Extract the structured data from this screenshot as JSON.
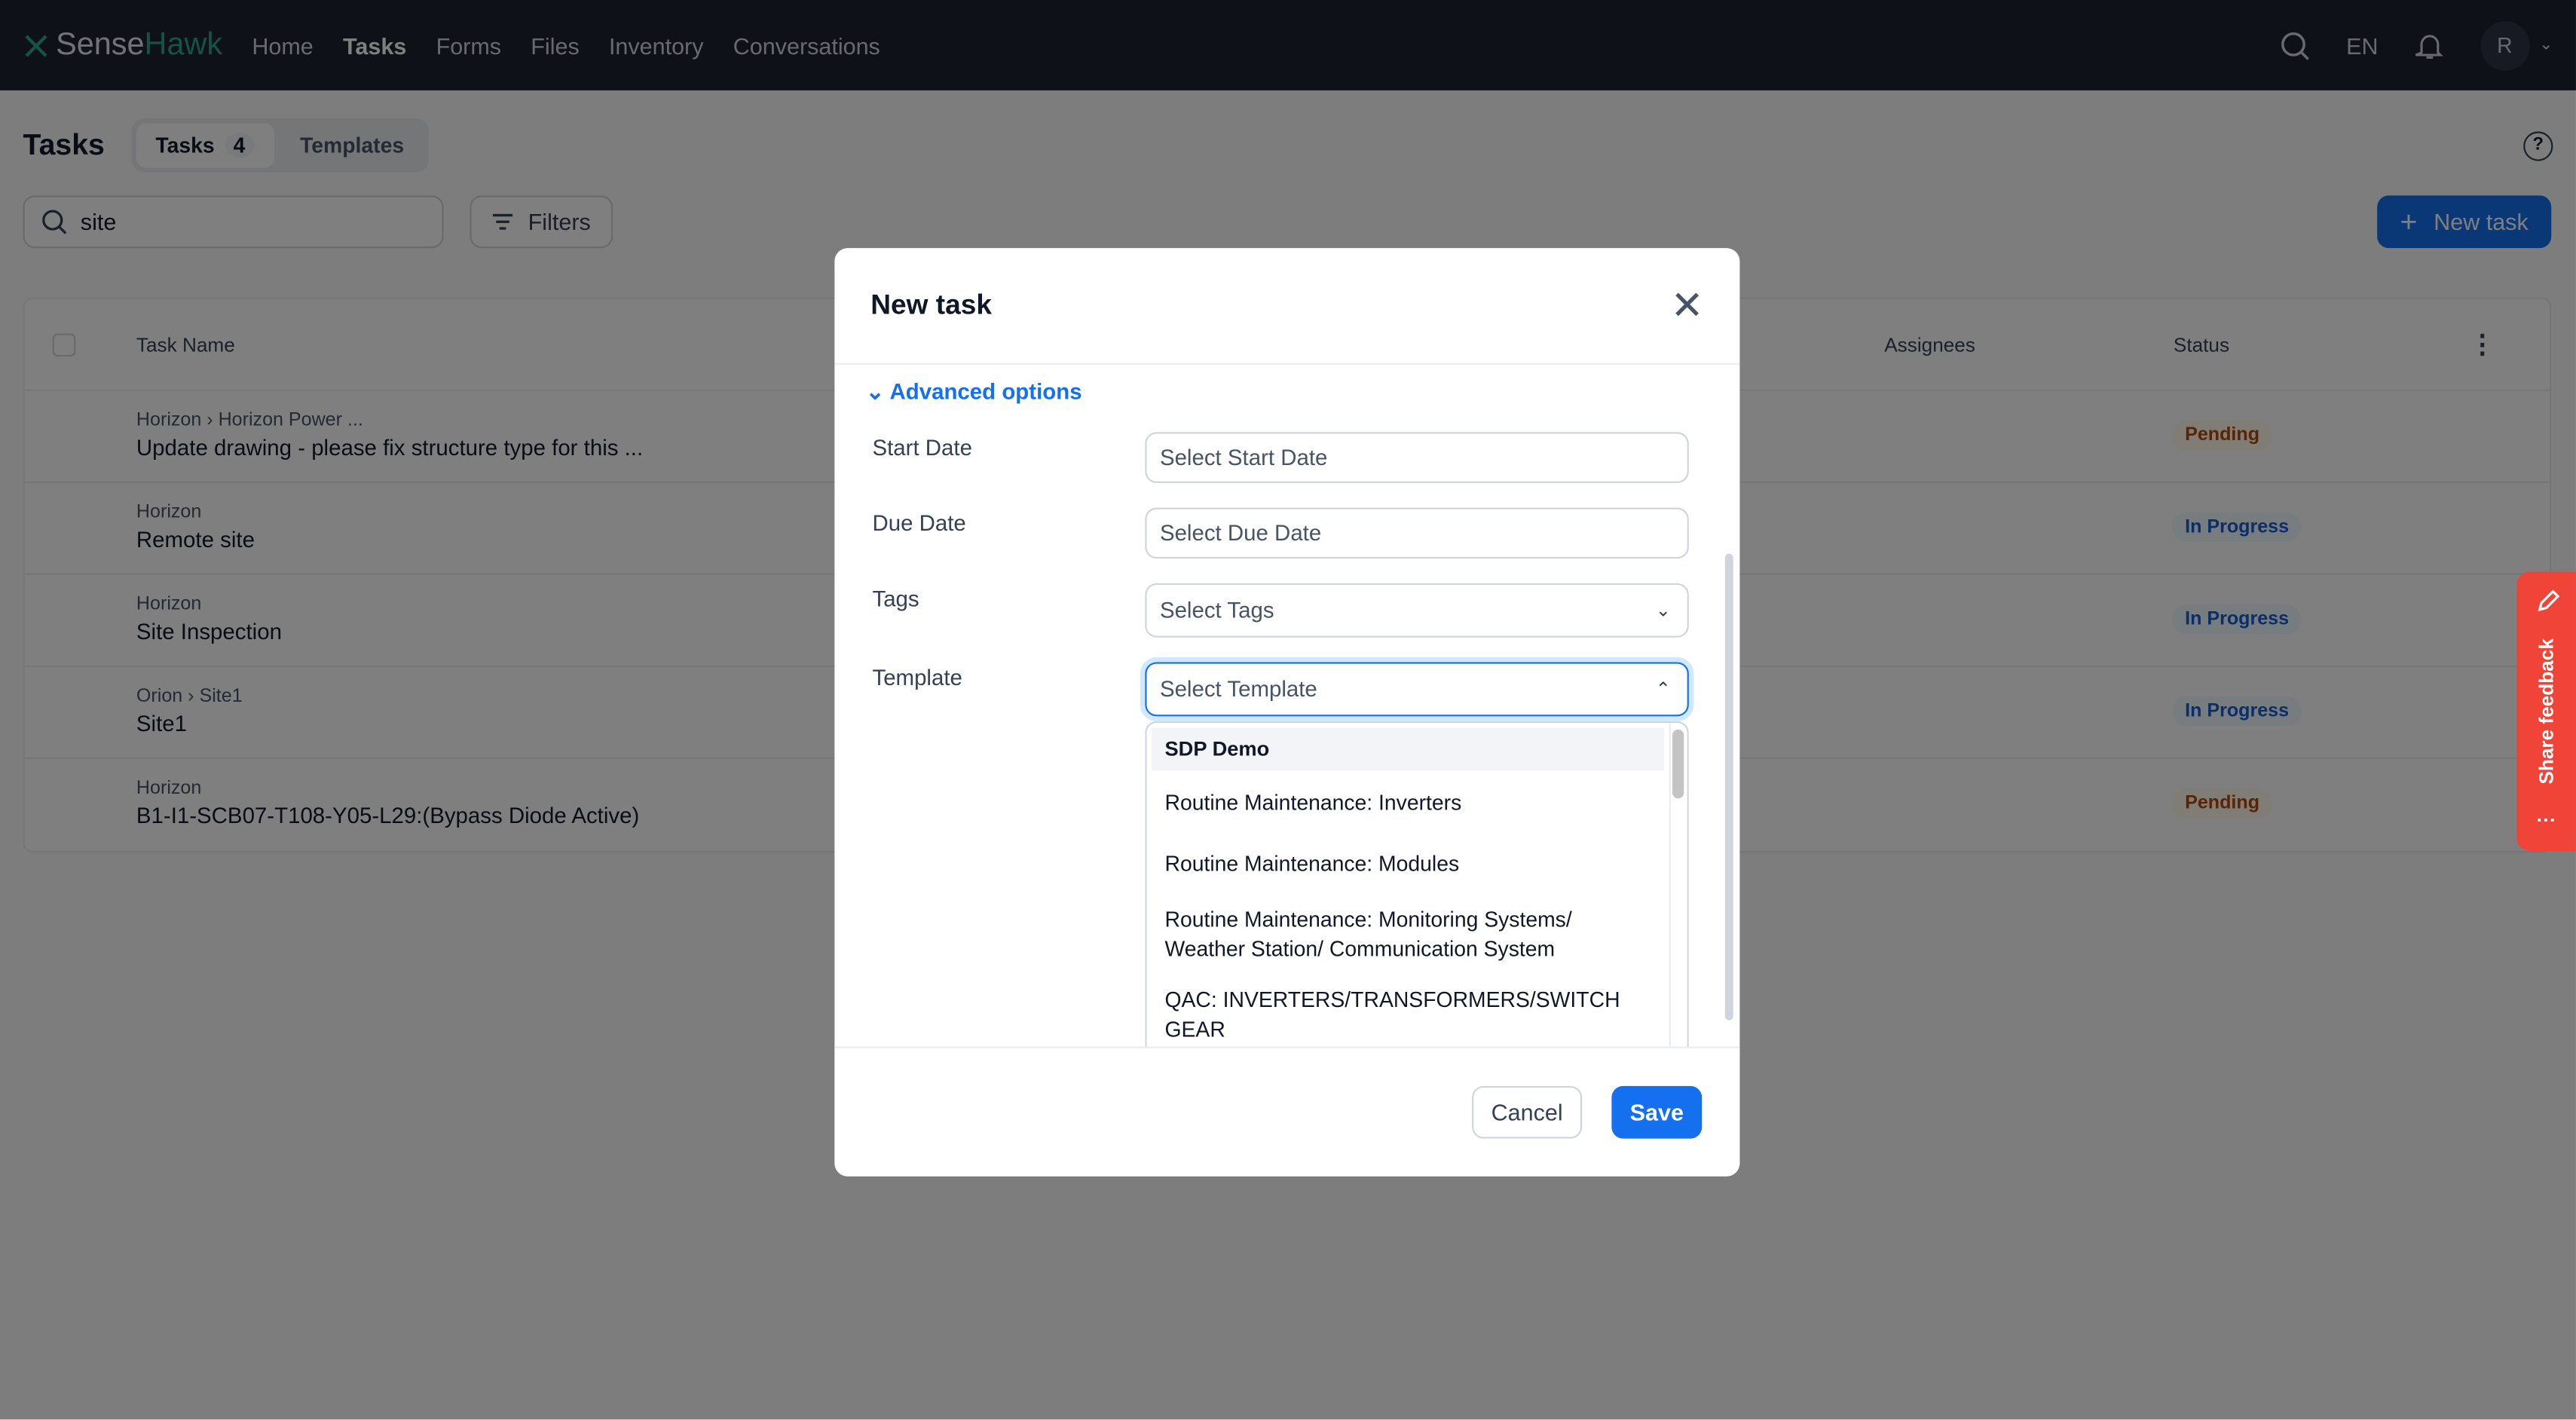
{
  "nav": {
    "brand_a": "Sense",
    "brand_b": "Hawk",
    "items": [
      "Home",
      "Tasks",
      "Forms",
      "Files",
      "Inventory",
      "Conversations"
    ],
    "active": "Tasks",
    "lang": "EN",
    "avatar": "R"
  },
  "page": {
    "title": "Tasks",
    "tabs": [
      {
        "label": "Tasks",
        "count": "4"
      },
      {
        "label": "Templates"
      }
    ],
    "search_value": "site",
    "filters_label": "Filters",
    "new_task_label": "New task"
  },
  "table": {
    "columns": [
      "Task Name",
      "Assignees",
      "Status"
    ],
    "rows": [
      {
        "crumb": "Horizon › Horizon Power ...",
        "name": "Update drawing - please fix structure type for this ...",
        "status": "Pending"
      },
      {
        "crumb": "Horizon",
        "name": "Remote site",
        "status": "In Progress"
      },
      {
        "crumb": "Horizon",
        "name": "Site Inspection",
        "status": "In Progress"
      },
      {
        "crumb": "Orion › Site1",
        "name": "Site1",
        "status": "In Progress"
      },
      {
        "crumb": "Horizon",
        "name": "B1-I1-SCB07-T108-Y05-L29:(Bypass Diode Active)",
        "status": "Pending"
      }
    ]
  },
  "feedback": {
    "label": "Share feedback"
  },
  "modal": {
    "title": "New task",
    "advanced": "Advanced options",
    "fields": [
      {
        "label": "Start Date",
        "placeholder": "Select Start Date"
      },
      {
        "label": "Due Date",
        "placeholder": "Select Due Date"
      },
      {
        "label": "Tags",
        "placeholder": "Select Tags"
      },
      {
        "label": "Template",
        "placeholder": "Select Template"
      }
    ],
    "template_options": {
      "group": "SDP Demo",
      "items": [
        "Routine Maintenance: Inverters",
        "Routine Maintenance: Modules",
        "Routine Maintenance: Monitoring Systems/ Weather Station/ Communication System",
        "QAC: INVERTERS/TRANSFORMERS/SWITCHGEAR"
      ]
    },
    "cancel": "Cancel",
    "save": "Save"
  },
  "colors": {
    "accent": "#1570ef",
    "nav_bg": "#1c2230",
    "feedback": "#f04438",
    "pending": "#b54708",
    "in_progress": "#175cd3"
  }
}
